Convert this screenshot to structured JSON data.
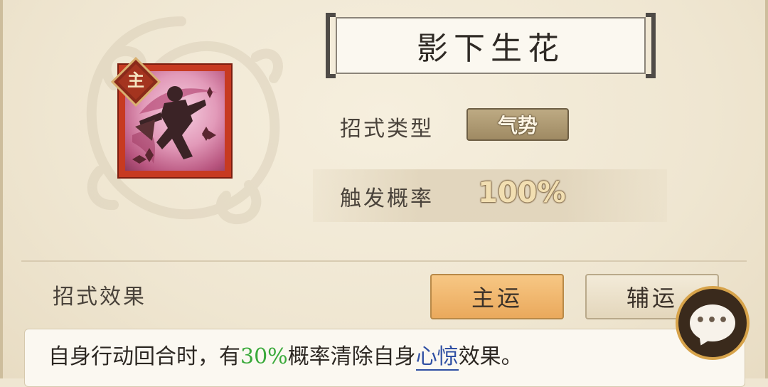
{
  "skill": {
    "title": "影下生花",
    "badge_main": "主",
    "icon": "ninja-flower-icon"
  },
  "info": {
    "type_label": "招式类型",
    "type_value": "气势",
    "rate_label": "触发概率",
    "rate_value": "100%"
  },
  "effect": {
    "label": "招式效果",
    "tabs": [
      {
        "label": "主运",
        "active": true
      },
      {
        "label": "辅运",
        "active": false
      }
    ],
    "description_prefix": "自身行动回合时，有",
    "description_pct": "30%",
    "description_mid": "概率清除自身",
    "description_link": "心惊",
    "description_suffix": "效果。"
  },
  "chat": {
    "icon": "chat-bubble-icon"
  },
  "colors": {
    "active_tab": "#eaa95c",
    "percent_green": "#39a93a",
    "link_blue": "#2f4fa3"
  }
}
